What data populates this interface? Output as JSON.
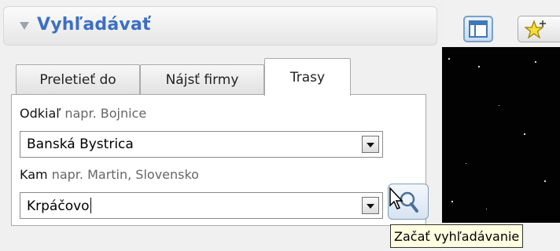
{
  "panel": {
    "title": "Vyhľadávať"
  },
  "tabs": [
    {
      "label": "Preletieť do",
      "active": false
    },
    {
      "label": "Nájsť firmy",
      "active": false
    },
    {
      "label": "Trasy",
      "active": true
    }
  ],
  "from": {
    "label": "Odkiaľ",
    "hint": "napr. Bojnice",
    "value": "Banská Bystrica"
  },
  "to": {
    "label": "Kam",
    "hint": "napr. Martin, Slovensko",
    "value": "Krpáčovo"
  },
  "search_button": {
    "tooltip": "Začať vyhľadávanie"
  },
  "icons": {
    "panel_toggle": "collapse-triangle-icon",
    "search": "magnifier-icon",
    "layout": "sidebar-layout-icon",
    "placemark": "add-placemark-star-icon"
  },
  "colors": {
    "title": "#3c6fc4",
    "map_background": "#020202",
    "tooltip_background": "#ffffe1"
  }
}
